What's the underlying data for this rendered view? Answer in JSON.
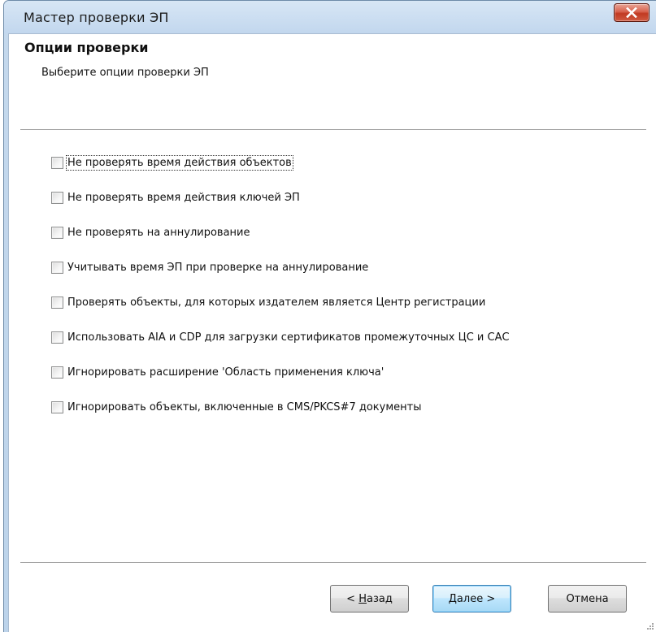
{
  "window": {
    "title": "Мастер проверки ЭП",
    "close_icon": "close-icon"
  },
  "header": {
    "title": "Опции проверки",
    "subtitle": "Выберите опции проверки ЭП"
  },
  "options": [
    {
      "label": "Не проверять время действия объектов",
      "checked": false,
      "focused": true
    },
    {
      "label": "Не проверять время действия ключей ЭП",
      "checked": false
    },
    {
      "label": "Не проверять на аннулирование",
      "checked": false
    },
    {
      "label": "Учитывать время ЭП при проверке на аннулирование",
      "checked": false
    },
    {
      "label": "Проверять объекты, для которых издателем является Центр регистрации",
      "checked": false
    },
    {
      "label": "Использовать AIA и CDP для загрузки сертификатов промежуточных ЦС и САС",
      "checked": false
    },
    {
      "label": "Игнорировать расширение 'Область применения ключа'",
      "checked": false
    },
    {
      "label": "Игнорировать объекты, включенные в CMS/PKCS#7 документы",
      "checked": false
    }
  ],
  "buttons": {
    "back": {
      "prefix": "< ",
      "mnemonic": "Н",
      "rest": "азад"
    },
    "next": {
      "mnemonic": "Д",
      "rest": "алее >"
    },
    "cancel": "Отмена"
  },
  "colors": {
    "titlebar": "#c4d8ec",
    "close_button": "#c13a22",
    "default_button_border": "#3c7fb1"
  }
}
